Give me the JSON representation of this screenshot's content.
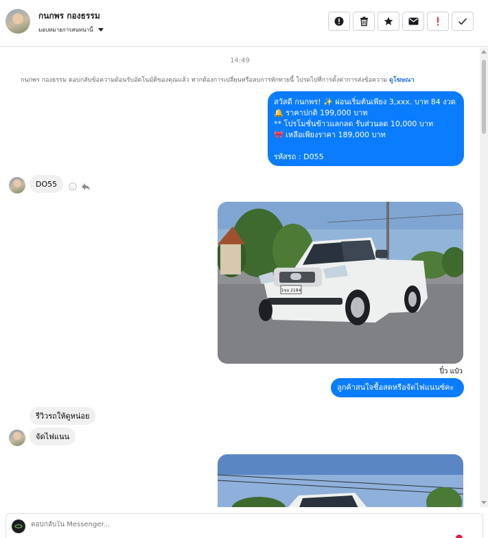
{
  "header": {
    "contact_name": "กนกพร กองธรรม",
    "assign_label": "มอบหมายการสนทนานี้",
    "actions": [
      {
        "name": "report-button",
        "icon": "alert-circle-icon"
      },
      {
        "name": "delete-button",
        "icon": "trash-icon"
      },
      {
        "name": "star-button",
        "icon": "star-icon"
      },
      {
        "name": "mark-unread-button",
        "icon": "envelope-icon"
      },
      {
        "name": "spam-button",
        "icon": "exclamation-icon"
      },
      {
        "name": "done-button",
        "icon": "check-icon"
      }
    ]
  },
  "thread": {
    "timestamp": "14:49",
    "system_note": "กนกพร กองธรรม ตอบกลับข้อความด้อนรับอัตโนมัติของคุณแล้ว หากต้องการเปลี่ยนหรือลบการทักทายนี้ โปรดไปที่การตั้งค่าการส่งข้อความ",
    "system_link": "ดูโฆษณา",
    "greeting": {
      "line1": "สวัสดี กนกพร! ✨  ผ่อนเริ่มต้นเพียง 3,xxx. บาท 84 งวด",
      "line2": "🔔 ราคาปกติ 199,000 บาท",
      "line3": "** โปรโมชั่นข้าวแลกลด รับส่วนลด 10,000 บาท",
      "line4": "🎀 เหลือเพียงราคา 189,000 บาท",
      "line5": "",
      "line6": "รหัสรถ : D055"
    },
    "incoming_1": "DO55",
    "photo_1_plate": "1ขล 2184",
    "sender_label": "ปิ๋ว แป๋ว",
    "outgoing_reply": "ลูกค้าสนใจซื้อสดหรือจัดไฟแนนซ์คะ",
    "incoming_2": "รีวิวรถให้ดูหน่อย",
    "incoming_3": "จัดไฟแนน"
  },
  "composer": {
    "placeholder": "ตอบกลับใน Messenger..."
  },
  "colors": {
    "outgoing_bubble": "#0a7cff",
    "incoming_bubble": "#f0f0f0",
    "link": "#216fdb",
    "spam_icon": "#f02849"
  }
}
